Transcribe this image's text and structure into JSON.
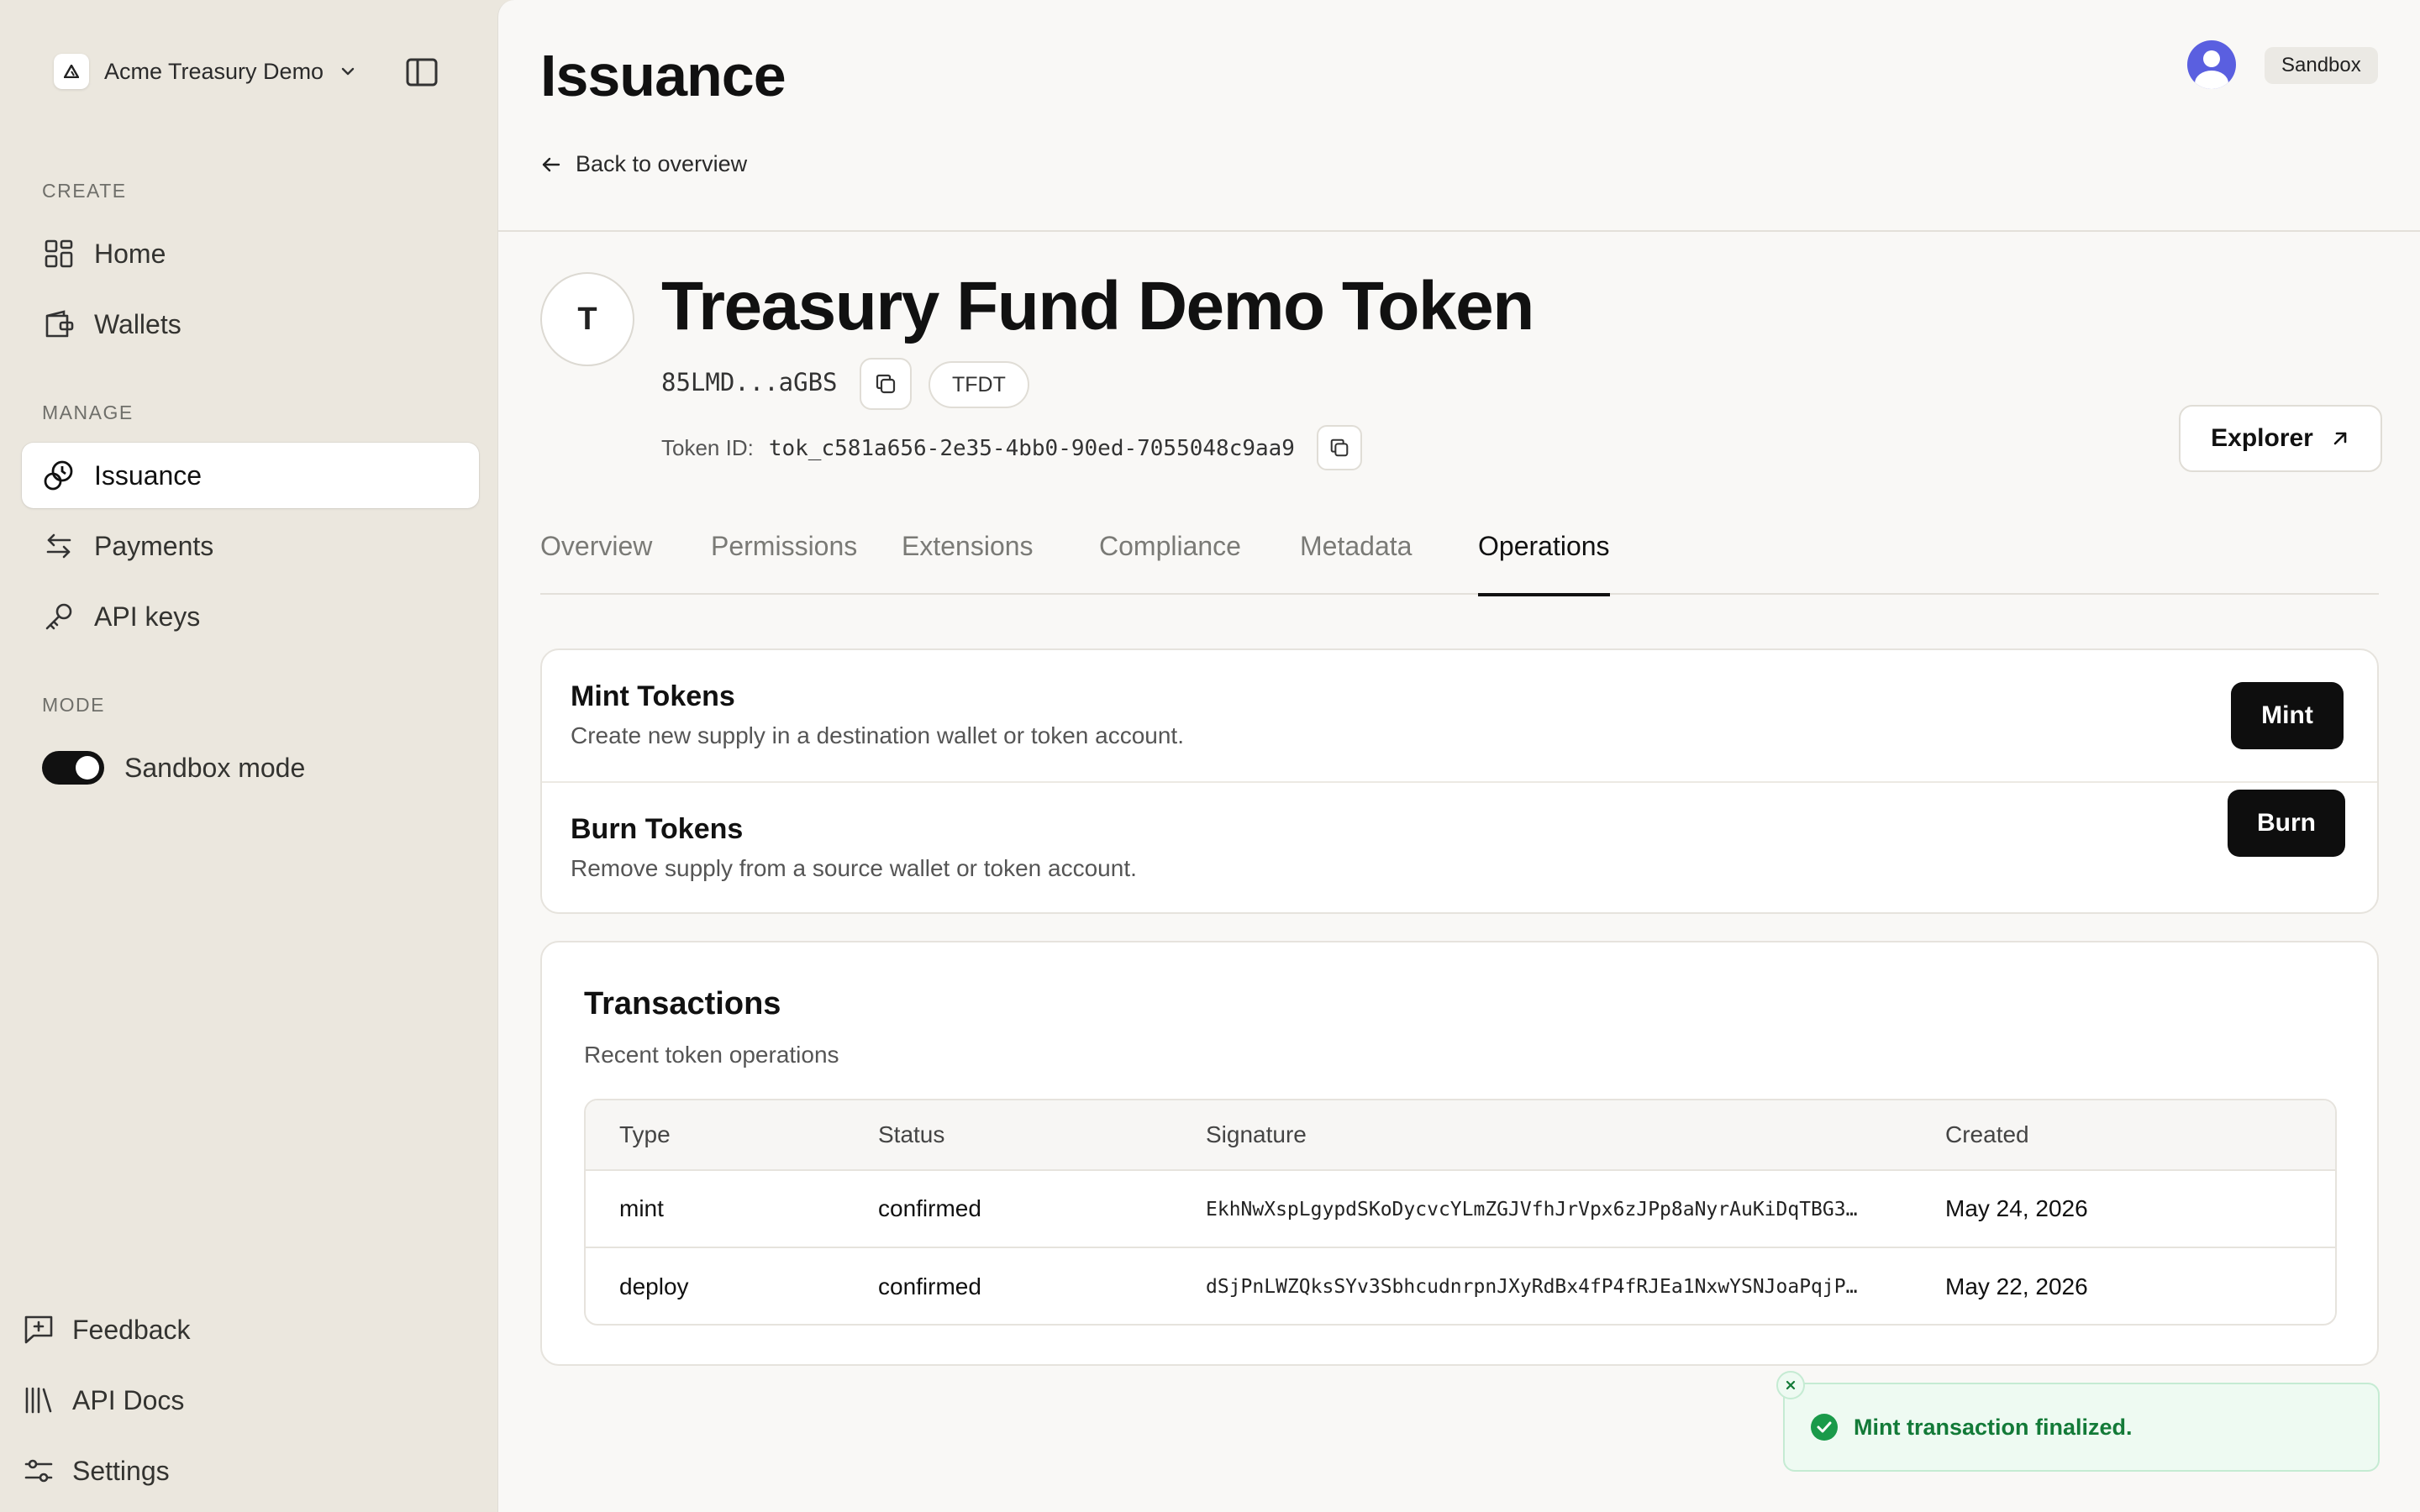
{
  "workspace": {
    "name": "Acme Treasury Demo"
  },
  "sidebar": {
    "sections": {
      "create": "CREATE",
      "manage": "MANAGE",
      "mode": "MODE"
    },
    "items": [
      {
        "label": "Home",
        "icon": "grid-icon"
      },
      {
        "label": "Wallets",
        "icon": "wallet-icon"
      },
      {
        "label": "Issuance",
        "icon": "coins-icon",
        "active": true
      },
      {
        "label": "Payments",
        "icon": "arrows-icon"
      },
      {
        "label": "API keys",
        "icon": "key-icon"
      }
    ],
    "mode_toggle": {
      "label": "Sandbox mode",
      "on": true
    },
    "footer": [
      {
        "label": "Feedback",
        "icon": "feedback-icon"
      },
      {
        "label": "API Docs",
        "icon": "library-icon"
      },
      {
        "label": "Settings",
        "icon": "sliders-icon"
      }
    ]
  },
  "header": {
    "title": "Issuance",
    "back_label": "Back to overview",
    "env_badge": "Sandbox"
  },
  "token": {
    "avatar_letter": "T",
    "name": "Treasury Fund Demo Token",
    "address_short": "85LMD...aGBS",
    "symbol": "TFDT",
    "id_label": "Token ID:",
    "id_value": "tok_c581a656-2e35-4bb0-90ed-7055048c9aa9",
    "explorer_label": "Explorer"
  },
  "tabs": [
    {
      "label": "Overview"
    },
    {
      "label": "Permissions"
    },
    {
      "label": "Extensions"
    },
    {
      "label": "Compliance"
    },
    {
      "label": "Metadata"
    },
    {
      "label": "Operations",
      "active": true
    }
  ],
  "operations": [
    {
      "title": "Mint Tokens",
      "description": "Create new supply in a destination wallet or token account.",
      "button": "Mint"
    },
    {
      "title": "Burn Tokens",
      "description": "Remove supply from a source wallet or token account.",
      "button": "Burn"
    }
  ],
  "transactions": {
    "title": "Transactions",
    "subtitle": "Recent token operations",
    "columns": [
      "Type",
      "Status",
      "Signature",
      "Created"
    ],
    "rows": [
      {
        "type": "mint",
        "status": "confirmed",
        "signature": "EkhNwXspLgypdSKoDycvcYLmZGJVfhJrVpx6zJPp8aNyrAuKiDqTBG3…",
        "created": "May 24, 2026"
      },
      {
        "type": "deploy",
        "status": "confirmed",
        "signature": "dSjPnLWZQksSYv3SbhcudnrpnJXyRdBx4fP4fRJEa1NxwYSNJoaPqjP…",
        "created": "May 22, 2026"
      }
    ]
  },
  "toast": {
    "message": "Mint transaction finalized."
  },
  "colors": {
    "accent": "#111111",
    "sidebar_bg": "#ebe7de",
    "success": "#137a38",
    "avatar": "#5a5fe0"
  }
}
